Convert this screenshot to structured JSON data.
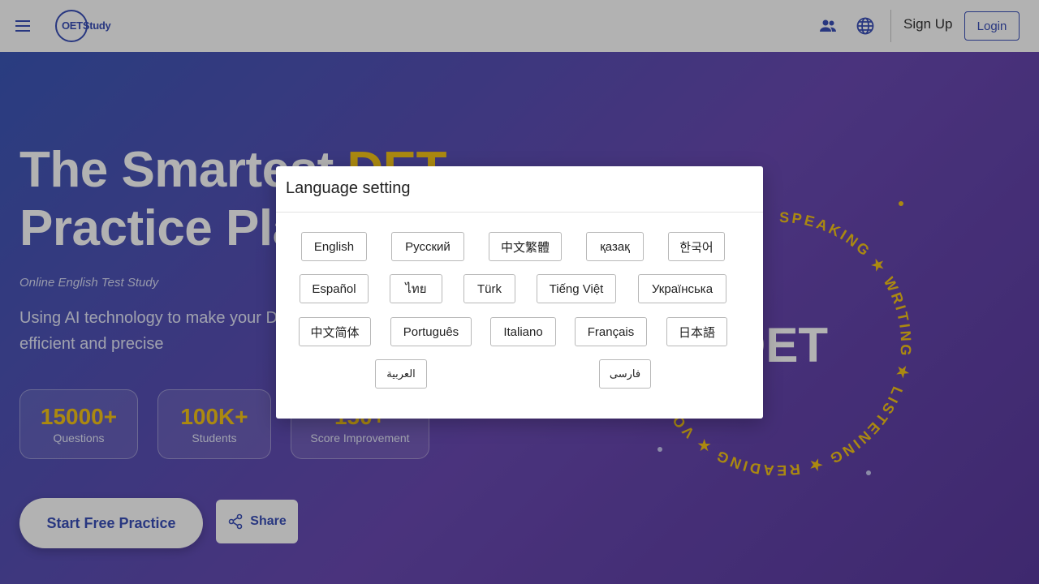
{
  "header": {
    "logo_text": "OETStudy",
    "signup_label": "Sign Up",
    "login_label": "Login"
  },
  "hero": {
    "title_line1": "The Smartest ",
    "title_highlight": "DET",
    "title_line2": "Practice Platform",
    "subtitle": "Online English Test Study",
    "description": "Using AI technology to make your DET preparation more efficient and precise",
    "stats": [
      {
        "value": "15000+",
        "label": "Questions"
      },
      {
        "value": "100K+",
        "label": "Students"
      },
      {
        "value": "150+",
        "label": "Score Improvement"
      }
    ],
    "start_label": "Start Free Practice",
    "share_label": "Share",
    "badge_center": "DET",
    "badge_ring_text": "SPEAKING ★ WRITING ★ LISTENING ★ READING ★ VOCABULARY ★ "
  },
  "modal": {
    "title": "Language setting",
    "languages": [
      "English",
      "Русский",
      "中文繁體",
      "қазақ",
      "한국어",
      "Español",
      "ไทย",
      "Türk",
      "Tiếng Việt",
      "Українська",
      "中文简体",
      "Português",
      "Italiano",
      "Français",
      "日本語",
      "العربية",
      "فارسی"
    ]
  },
  "colors": {
    "brand": "#3a4fb8",
    "accent": "#f5c518"
  }
}
